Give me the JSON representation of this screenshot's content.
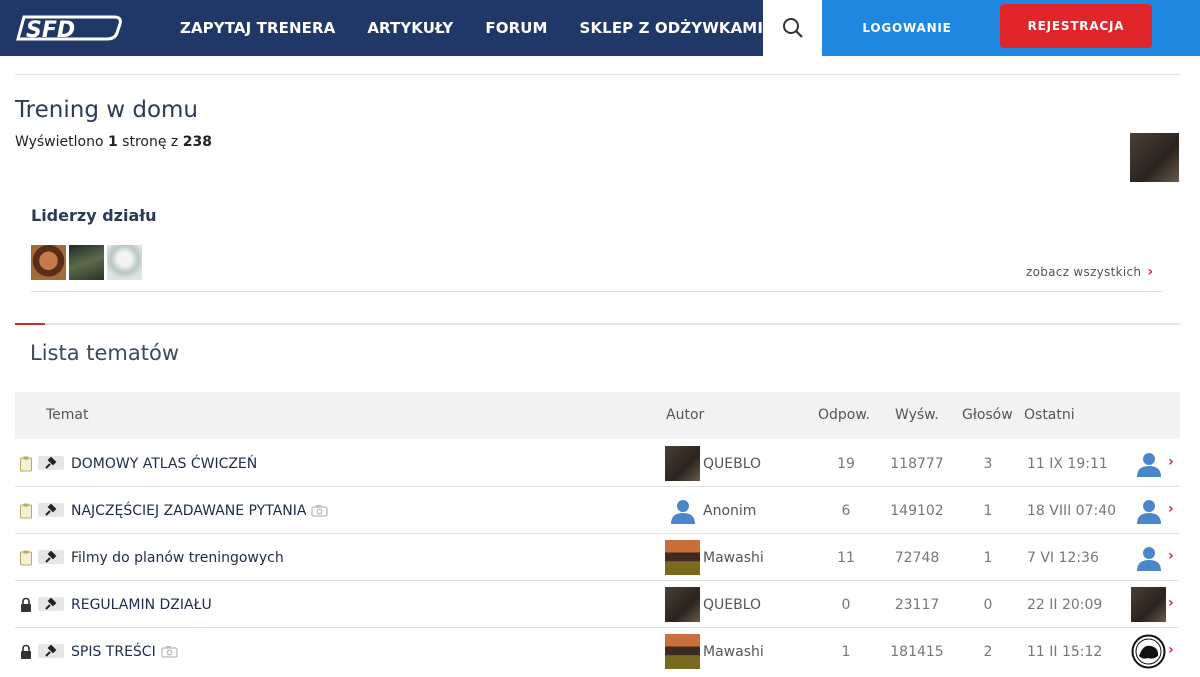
{
  "header": {
    "logo_text": "SFD",
    "nav": [
      {
        "label": "ZAPYTAJ TRENERA"
      },
      {
        "label": "ARTYKUŁY"
      },
      {
        "label": "FORUM"
      },
      {
        "label": "SKLEP Z ODŻYWKAMI"
      }
    ],
    "login_label": "LOGOWANIE",
    "register_label": "REJESTRACJA",
    "colors": {
      "navbar": "#1f3868",
      "login_bg": "#1f87e0",
      "register_bg": "#e0262b"
    }
  },
  "forum": {
    "title": "Trening w domu",
    "pages_prefix": "Wyświetlono",
    "pages_current": "1",
    "pages_middle": "stronę z",
    "pages_total": "238"
  },
  "leaders": {
    "title": "Liderzy działu",
    "see_all": "zobacz wszystkich"
  },
  "topics": {
    "title": "Lista tematów",
    "columns": {
      "topic": "Temat",
      "author": "Autor",
      "replies": "Odpow.",
      "views": "Wyśw.",
      "votes": "Głosów",
      "last": "Ostatni"
    },
    "rows": [
      {
        "title": "DOMOWY ATLAS ĆWICZEŃ",
        "author": "QUEBLO",
        "replies": "19",
        "views": "118777",
        "votes": "3",
        "last": "11 IX 19:11"
      },
      {
        "title": "NAJCZĘŚCIEJ ZADAWANE PYTANIA",
        "author": "Anonim",
        "replies": "6",
        "views": "149102",
        "votes": "1",
        "last": "18 VIII 07:40"
      },
      {
        "title": "Filmy do planów treningowych",
        "author": "Mawashi",
        "replies": "11",
        "views": "72748",
        "votes": "1",
        "last": "7 VI 12:36"
      },
      {
        "title": "REGULAMIN DZIAŁU",
        "author": "QUEBLO",
        "replies": "0",
        "views": "23117",
        "votes": "0",
        "last": "22 II 20:09"
      },
      {
        "title": "SPIS TREŚCI",
        "author": "Mawashi",
        "replies": "1",
        "views": "181415",
        "votes": "2",
        "last": "11 II 15:12"
      }
    ]
  }
}
